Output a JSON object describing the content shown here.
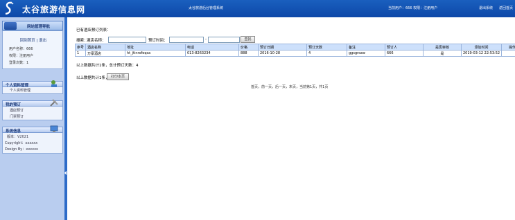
{
  "header": {
    "site_title": "太谷旅游信息网",
    "system_name": "太谷旅游后台管理系统",
    "current_user": "当前用户：666 权限：注册用户",
    "logout": "退出系统",
    "home": "返回首页"
  },
  "sidebar": {
    "nav_title": "网站管理导航",
    "back_home": "回到首页",
    "separator": "|",
    "logout": "退出",
    "user_lines": [
      "用户名称：666",
      "权限：注册用户",
      "登录次数：1"
    ],
    "sections": [
      {
        "title": "个人资料管理",
        "items": [
          "个人资料管理"
        ]
      },
      {
        "title": "我的预订",
        "items": [
          "酒店预订",
          "门票预订"
        ]
      },
      {
        "title": "系统信息",
        "items": [
          "版本：V2021",
          "Copyright：xxxxxx",
          "Design By：xxxxxx"
        ]
      }
    ]
  },
  "main": {
    "title": "已有酒店预订列表：",
    "search": {
      "prefix": "搜索：",
      "name_label": "酒店名称：",
      "name_value": "",
      "time_label": "预订时间：",
      "time_from": "",
      "range_sep": "-",
      "time_to": "",
      "button": "查找"
    },
    "table": {
      "headers": [
        "序号",
        "酒店名称",
        "地址",
        "电话",
        "价格",
        "预订日期",
        "预订天数",
        "备注",
        "预订人",
        "是否审核",
        "添加时间",
        "操作"
      ],
      "rows": [
        [
          "1",
          "万豪酒店",
          "ht_jtinrofeqsa",
          "013-8263234",
          "888",
          "2016-10-28",
          "4",
          "ggsgrsaw",
          "666",
          "是",
          "2019-03-12 22:53:52",
          ""
        ]
      ]
    },
    "summary": "以上数据共计1条，总计预订天数：4",
    "export_label": "以上数据共计1条，",
    "export_button": "打印本页",
    "pager": "首页，前一页，后一页，末页，当前第1页，共1页"
  }
}
